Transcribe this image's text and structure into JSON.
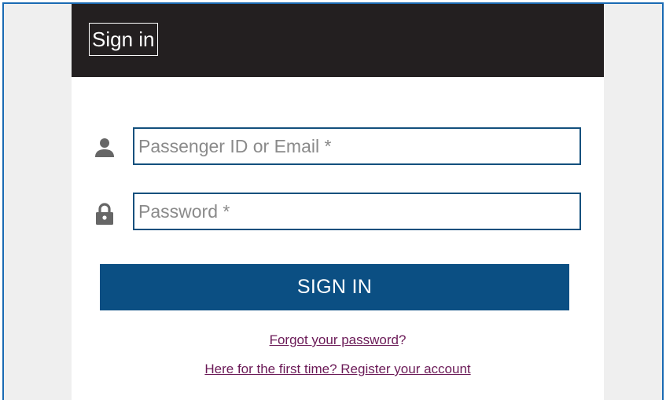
{
  "header": {
    "title": "Sign in"
  },
  "form": {
    "username": {
      "icon": "user-icon",
      "placeholder": "Passenger ID or Email *",
      "value": ""
    },
    "password": {
      "icon": "lock-icon",
      "placeholder": "Password *",
      "value": ""
    },
    "submit_label": "SIGN IN"
  },
  "links": {
    "forgot_text": "Forgot your password",
    "forgot_suffix": "?",
    "register_text": "Here for the first time? Register your account"
  },
  "colors": {
    "header_background": "#231f20",
    "primary_button": "#0b4f83",
    "input_border": "#13507d",
    "link": "#6b1a57",
    "page_background": "#efefef",
    "frame_border": "#1a6ab3",
    "icon": "#666666"
  }
}
